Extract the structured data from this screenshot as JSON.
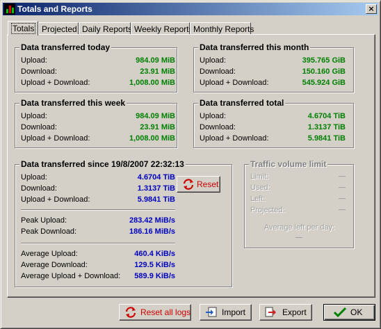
{
  "window": {
    "title": "Totals and Reports",
    "close_glyph": "×"
  },
  "tabs": [
    {
      "label": "Totals"
    },
    {
      "label": "Projected"
    },
    {
      "label": "Daily Reports"
    },
    {
      "label": "Weekly Reports"
    },
    {
      "label": "Monthly Reports"
    }
  ],
  "today": {
    "title": "Data transferred today",
    "rows": [
      {
        "label": "Upload:",
        "value": "984.09 MiB"
      },
      {
        "label": "Download:",
        "value": "23.91 MiB"
      },
      {
        "label": "Upload + Download:",
        "value": "1,008.00 MiB"
      }
    ]
  },
  "month": {
    "title": "Data transferred this month",
    "rows": [
      {
        "label": "Upload:",
        "value": "395.765 GiB"
      },
      {
        "label": "Download:",
        "value": "150.160 GiB"
      },
      {
        "label": "Upload + Download:",
        "value": "545.924 GiB"
      }
    ]
  },
  "week": {
    "title": "Data transferred this week",
    "rows": [
      {
        "label": "Upload:",
        "value": "984.09 MiB"
      },
      {
        "label": "Download:",
        "value": "23.91 MiB"
      },
      {
        "label": "Upload + Download:",
        "value": "1,008.00 MiB"
      }
    ]
  },
  "total": {
    "title": "Data transferred total",
    "rows": [
      {
        "label": "Upload:",
        "value": "4.6704 TiB"
      },
      {
        "label": "Download:",
        "value": "1.3137 TiB"
      },
      {
        "label": "Upload + Download:",
        "value": "5.9841 TiB"
      }
    ]
  },
  "since": {
    "title": "Data transferred since 19/8/2007 22:32:13",
    "rows": [
      {
        "label": "Upload:",
        "value": "4.6704 TiB"
      },
      {
        "label": "Download:",
        "value": "1.3137 TiB"
      },
      {
        "label": "Upload + Download:",
        "value": "5.9841 TiB"
      }
    ],
    "peak": [
      {
        "label": "Peak Upload:",
        "value": "283.42 MiB/s"
      },
      {
        "label": "Peak Download:",
        "value": "186.16 MiB/s"
      }
    ],
    "average": [
      {
        "label": "Average Upload:",
        "value": "460.4 KiB/s"
      },
      {
        "label": "Average Download:",
        "value": "129.5 KiB/s"
      },
      {
        "label": "Average Upload + Download:",
        "value": "589.9 KiB/s"
      }
    ],
    "reset_label": "Reset"
  },
  "limit": {
    "title": "Traffic volume limit",
    "labels": [
      "Limit:",
      "Used:",
      "Left:",
      "Projected:"
    ],
    "avg_label": "Average left per day:"
  },
  "footer": {
    "reset_all_label": "Reset all logs",
    "import_label": "Import",
    "export_label": "Export",
    "ok_label": "OK"
  },
  "colors": {
    "value_green": "#008000",
    "value_blue": "#0000c0",
    "titlebar": "#0a246a",
    "reset_red": "#cc0000"
  },
  "icons": [
    "app-icon",
    "close-icon",
    "reset-icon",
    "import-icon",
    "export-icon",
    "ok-check-icon"
  ]
}
